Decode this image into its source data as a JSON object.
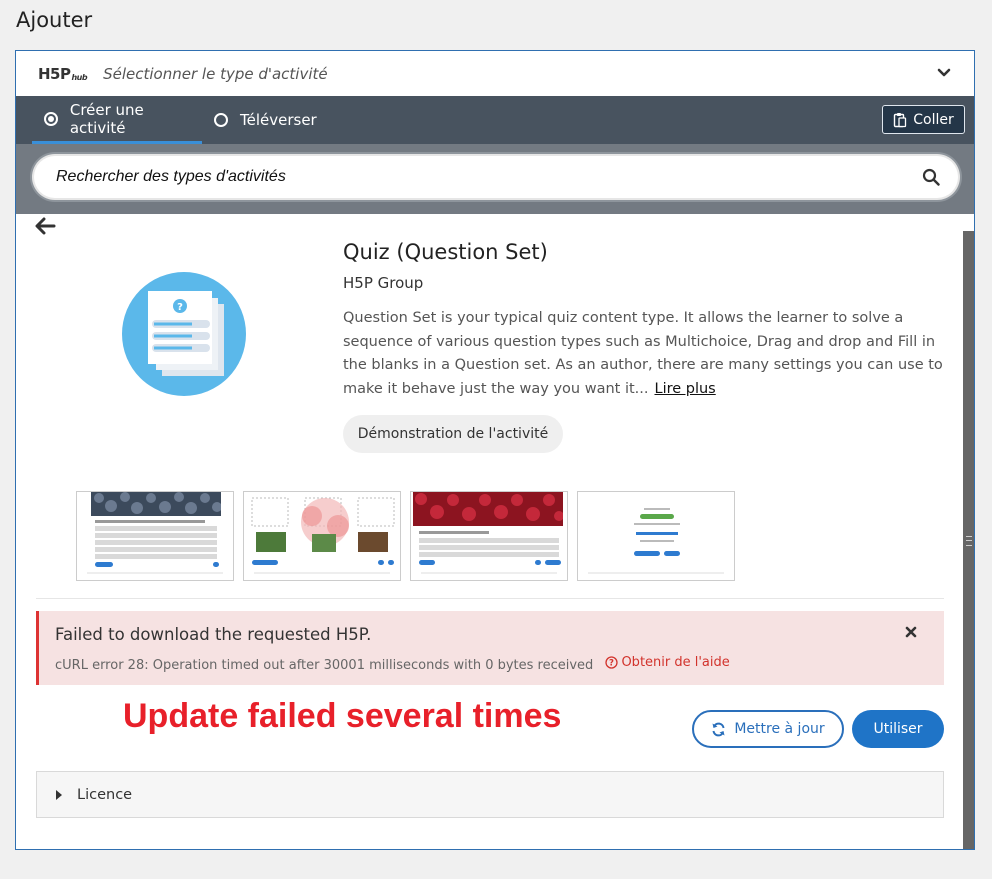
{
  "page": {
    "heading": "Ajouter"
  },
  "hub": {
    "logo": "H5P",
    "logo_suffix": "hub",
    "title": "Sélectionner le type d'activité"
  },
  "tabs": [
    {
      "label": "Créer une activité",
      "selected": true
    },
    {
      "label": "Téléverser",
      "selected": false
    }
  ],
  "toolbar": {
    "paste_label": "Coller"
  },
  "search": {
    "placeholder": "Rechercher des types d'activités"
  },
  "content_type": {
    "title": "Quiz (Question Set)",
    "owner": "H5P Group",
    "description": "Question Set is your typical quiz content type. It allows the learner to solve a sequence of various question types such as Multichoice, Drag and drop and Fill in the blanks in a Question set. As an author, there are many settings you can use to make it behave just the way you want it...",
    "read_more": "Lire plus",
    "demo_label": "Démonstration de l'activité",
    "screenshot_count": 4
  },
  "error": {
    "title": "Failed to download the requested H5P.",
    "message": "cURL error 28: Operation timed out after 30001 milliseconds with 0 bytes received",
    "help_label": "Obtenir de l'aide"
  },
  "annotation": {
    "text": "Update failed several times",
    "color": "#e8202a"
  },
  "actions": {
    "update_label": "Mettre à jour",
    "use_label": "Utiliser"
  },
  "licence": {
    "label": "Licence"
  },
  "colors": {
    "accent": "#1f74c7",
    "tab_bar": "#48535f",
    "search_bar": "#737a82",
    "error_bg": "#f6e2e2",
    "error_text": "#d2332c",
    "icon_circle": "#5bb8ea"
  }
}
